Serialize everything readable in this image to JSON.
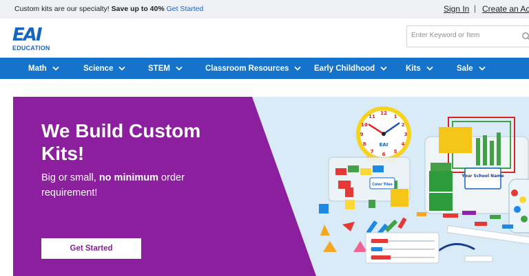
{
  "topbar": {
    "promo_prefix": "Custom kits are our specialty!",
    "promo_bold": "Save up to 40%",
    "promo_link": "Get Started",
    "signin": "Sign In",
    "separator": "|",
    "create_account": "Create an Acco"
  },
  "header": {
    "logo_mark": "EAI",
    "logo_text": "EDUCATION",
    "search_placeholder": "Enter Keyword or Item",
    "search_icon": "search-icon"
  },
  "nav": {
    "items": [
      {
        "label": "Math"
      },
      {
        "label": "Science"
      },
      {
        "label": "STEM"
      },
      {
        "label": "Classroom Resources"
      },
      {
        "label": "Early Childhood"
      },
      {
        "label": "Kits"
      },
      {
        "label": "Sale"
      }
    ]
  },
  "hero": {
    "title": "We Build Custom Kits!",
    "sub_prefix": "Big or small,",
    "sub_bold": "no minimum",
    "sub_suffix": "order requirement!",
    "cta_label": "Get Started",
    "product_label": "Your School Name",
    "tile_label": "Color Tiles",
    "clock_logo": "EAI",
    "colors": {
      "purple": "#8c1f9d",
      "sky": "#d8ebf7",
      "nav_blue": "#1673cc",
      "brand_blue": "#1665c0"
    }
  }
}
